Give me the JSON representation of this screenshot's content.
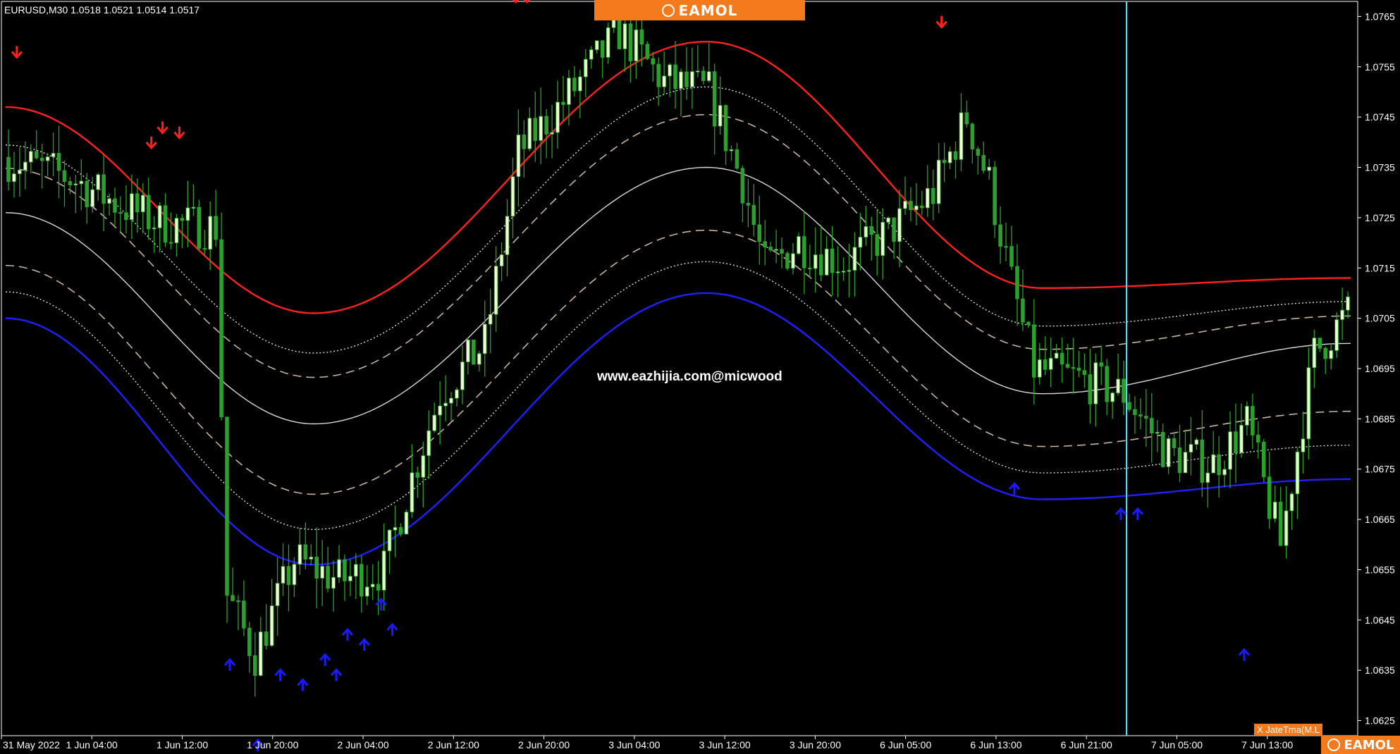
{
  "header": {
    "symbol_info": "EURUSD,M30  1.0518 1.0521 1.0514 1.0517"
  },
  "watermark": "www.eazhijia.com@micwood",
  "indicator_label": "X JateTma(M.L",
  "brand": {
    "top": "EAMOL",
    "bottom": "EAMOL"
  },
  "colors": {
    "background": "#000000",
    "bull": "#eaffd0",
    "bear": "#2ca02c",
    "upper_band": "#ff2020",
    "lower_band": "#2020ff",
    "mid_line": "#d8d8d8",
    "dashed": "#c8b49a",
    "dotted": "#e0e0e0",
    "vline": "#40e0ff",
    "buy_arrow": "#1a1aff",
    "sell_arrow": "#ff2020"
  },
  "chart_data": {
    "type": "candlestick",
    "symbol": "EURUSD",
    "timeframe": "M30",
    "ylim": [
      1.0622,
      1.0768
    ],
    "y_ticks": [
      "1.0765",
      "1.0755",
      "1.0745",
      "1.0735",
      "1.0725",
      "1.0715",
      "1.0705",
      "1.0695",
      "1.0685",
      "1.0675",
      "1.0665",
      "1.0655",
      "1.0645",
      "1.0635",
      "1.0625"
    ],
    "x_ticks": [
      "31 May 2022",
      "1 Jun 04:00",
      "1 Jun 12:00",
      "1 Jun 20:00",
      "2 Jun 04:00",
      "2 Jun 12:00",
      "2 Jun 20:00",
      "3 Jun 04:00",
      "3 Jun 12:00",
      "3 Jun 20:00",
      "6 Jun 05:00",
      "6 Jun 13:00",
      "6 Jun 21:00",
      "7 Jun 05:00",
      "7 Jun 13:00"
    ],
    "bar_count": 240,
    "vertical_line_bar": 200,
    "bands": {
      "upper_anchors": [
        [
          0,
          1.0747
        ],
        [
          55,
          1.0706
        ],
        [
          125,
          1.076
        ],
        [
          185,
          1.0711
        ],
        [
          240,
          1.0713
        ]
      ],
      "center_anchors": [
        [
          0,
          1.0726
        ],
        [
          55,
          1.0684
        ],
        [
          125,
          1.0735
        ],
        [
          185,
          1.069
        ],
        [
          240,
          1.07
        ]
      ],
      "lower_anchors": [
        [
          0,
          1.0705
        ],
        [
          55,
          1.0656
        ],
        [
          125,
          1.071
        ],
        [
          185,
          1.0669
        ],
        [
          240,
          1.0673
        ]
      ]
    },
    "close_anchors": [
      [
        0,
        1.0737
      ],
      [
        12,
        1.0733
      ],
      [
        20,
        1.0728
      ],
      [
        28,
        1.0724
      ],
      [
        38,
        1.0723
      ],
      [
        40,
        1.065
      ],
      [
        45,
        1.0638
      ],
      [
        52,
        1.0657
      ],
      [
        60,
        1.0653
      ],
      [
        68,
        1.0655
      ],
      [
        72,
        1.067
      ],
      [
        78,
        1.069
      ],
      [
        86,
        1.07
      ],
      [
        92,
        1.0738
      ],
      [
        100,
        1.0748
      ],
      [
        110,
        1.0762
      ],
      [
        118,
        1.0752
      ],
      [
        126,
        1.075
      ],
      [
        132,
        1.0732
      ],
      [
        136,
        1.0715
      ],
      [
        142,
        1.072
      ],
      [
        150,
        1.0716
      ],
      [
        158,
        1.0722
      ],
      [
        166,
        1.073
      ],
      [
        172,
        1.0745
      ],
      [
        176,
        1.0732
      ],
      [
        180,
        1.0712
      ],
      [
        184,
        1.0695
      ],
      [
        192,
        1.0693
      ],
      [
        200,
        1.069
      ],
      [
        208,
        1.0678
      ],
      [
        216,
        1.0676
      ],
      [
        222,
        1.0684
      ],
      [
        228,
        1.066
      ],
      [
        234,
        1.0698
      ],
      [
        240,
        1.0706
      ]
    ],
    "buy_arrows": [
      [
        40,
        1.0636
      ],
      [
        49,
        1.0634
      ],
      [
        53,
        1.0632
      ],
      [
        57,
        1.0637
      ],
      [
        59,
        1.0634
      ],
      [
        61,
        1.0642
      ],
      [
        64,
        1.064
      ],
      [
        67,
        1.0648
      ],
      [
        69,
        1.0643
      ],
      [
        180,
        1.0671
      ],
      [
        199,
        1.0666
      ],
      [
        202,
        1.0666
      ],
      [
        221,
        1.0638
      ],
      [
        45,
        1.062
      ]
    ],
    "sell_arrows": [
      [
        2,
        1.0758
      ],
      [
        26,
        1.074
      ],
      [
        28,
        1.0743
      ],
      [
        31,
        1.0742
      ],
      [
        91,
        1.0769
      ],
      [
        93,
        1.0769
      ],
      [
        107,
        1.0771
      ],
      [
        167,
        1.0764
      ]
    ]
  }
}
